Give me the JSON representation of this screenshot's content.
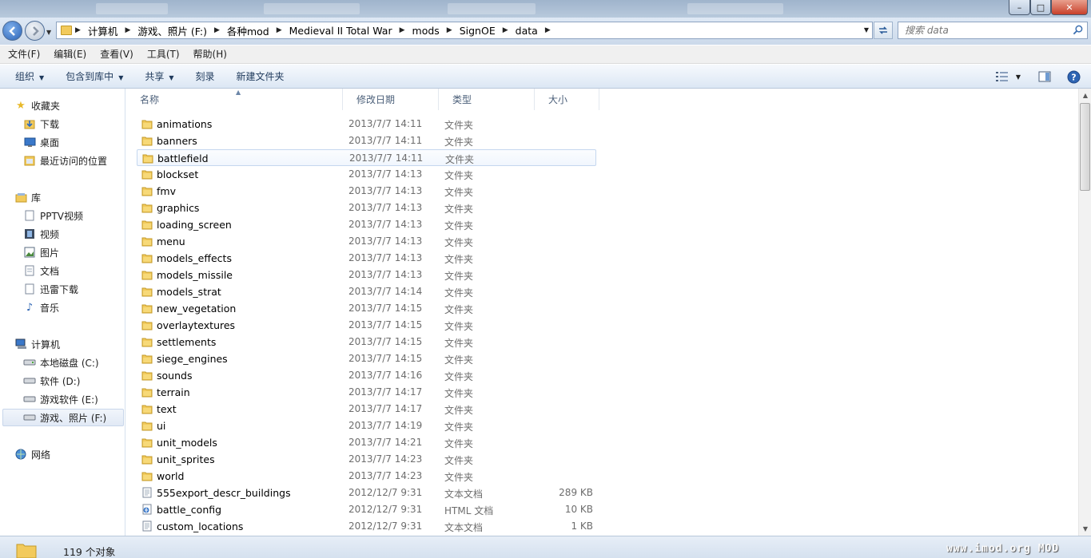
{
  "window": {
    "close_glyph": "✕",
    "maximize_glyph": "□",
    "minimize_glyph": "–"
  },
  "address": {
    "breadcrumbs": [
      "计算机",
      "游戏、照片 (F:)",
      "各种mod",
      "Medieval II Total War",
      "mods",
      "SignOE",
      "data"
    ],
    "search_placeholder": "搜索 data"
  },
  "menu": [
    "文件(F)",
    "编辑(E)",
    "查看(V)",
    "工具(T)",
    "帮助(H)"
  ],
  "toolbar": {
    "organize": "组织",
    "include_library": "包含到库中",
    "share": "共享",
    "burn": "刻录",
    "new_folder": "新建文件夹"
  },
  "nav": {
    "favorites": "收藏夹",
    "downloads": "下载",
    "desktop": "桌面",
    "recent": "最近访问的位置",
    "libraries": "库",
    "pptv": "PPTV视频",
    "videos": "视频",
    "pictures": "图片",
    "documents": "文档",
    "xunlei": "迅雷下载",
    "music": "音乐",
    "computer": "计算机",
    "drive_c": "本地磁盘 (C:)",
    "drive_d": "软件 (D:)",
    "drive_e": "游戏软件 (E:)",
    "drive_f": "游戏、照片 (F:)",
    "network": "网络"
  },
  "columns": {
    "name": "名称",
    "date": "修改日期",
    "type": "类型",
    "size": "大小"
  },
  "files": [
    {
      "name": "animations",
      "date": "2013/7/7 14:11",
      "type": "文件夹",
      "size": "",
      "kind": "folder"
    },
    {
      "name": "banners",
      "date": "2013/7/7 14:11",
      "type": "文件夹",
      "size": "",
      "kind": "folder"
    },
    {
      "name": "battlefield",
      "date": "2013/7/7 14:11",
      "type": "文件夹",
      "size": "",
      "kind": "folder"
    },
    {
      "name": "blockset",
      "date": "2013/7/7 14:13",
      "type": "文件夹",
      "size": "",
      "kind": "folder"
    },
    {
      "name": "fmv",
      "date": "2013/7/7 14:13",
      "type": "文件夹",
      "size": "",
      "kind": "folder"
    },
    {
      "name": "graphics",
      "date": "2013/7/7 14:13",
      "type": "文件夹",
      "size": "",
      "kind": "folder"
    },
    {
      "name": "loading_screen",
      "date": "2013/7/7 14:13",
      "type": "文件夹",
      "size": "",
      "kind": "folder"
    },
    {
      "name": "menu",
      "date": "2013/7/7 14:13",
      "type": "文件夹",
      "size": "",
      "kind": "folder"
    },
    {
      "name": "models_effects",
      "date": "2013/7/7 14:13",
      "type": "文件夹",
      "size": "",
      "kind": "folder"
    },
    {
      "name": "models_missile",
      "date": "2013/7/7 14:13",
      "type": "文件夹",
      "size": "",
      "kind": "folder"
    },
    {
      "name": "models_strat",
      "date": "2013/7/7 14:14",
      "type": "文件夹",
      "size": "",
      "kind": "folder"
    },
    {
      "name": "new_vegetation",
      "date": "2013/7/7 14:15",
      "type": "文件夹",
      "size": "",
      "kind": "folder"
    },
    {
      "name": "overlaytextures",
      "date": "2013/7/7 14:15",
      "type": "文件夹",
      "size": "",
      "kind": "folder"
    },
    {
      "name": "settlements",
      "date": "2013/7/7 14:15",
      "type": "文件夹",
      "size": "",
      "kind": "folder"
    },
    {
      "name": "siege_engines",
      "date": "2013/7/7 14:15",
      "type": "文件夹",
      "size": "",
      "kind": "folder"
    },
    {
      "name": "sounds",
      "date": "2013/7/7 14:16",
      "type": "文件夹",
      "size": "",
      "kind": "folder"
    },
    {
      "name": "terrain",
      "date": "2013/7/7 14:17",
      "type": "文件夹",
      "size": "",
      "kind": "folder"
    },
    {
      "name": "text",
      "date": "2013/7/7 14:17",
      "type": "文件夹",
      "size": "",
      "kind": "folder"
    },
    {
      "name": "ui",
      "date": "2013/7/7 14:19",
      "type": "文件夹",
      "size": "",
      "kind": "folder"
    },
    {
      "name": "unit_models",
      "date": "2013/7/7 14:21",
      "type": "文件夹",
      "size": "",
      "kind": "folder"
    },
    {
      "name": "unit_sprites",
      "date": "2013/7/7 14:23",
      "type": "文件夹",
      "size": "",
      "kind": "folder"
    },
    {
      "name": "world",
      "date": "2013/7/7 14:23",
      "type": "文件夹",
      "size": "",
      "kind": "folder"
    },
    {
      "name": "555export_descr_buildings",
      "date": "2012/12/7 9:31",
      "type": "文本文档",
      "size": "289 KB",
      "kind": "text"
    },
    {
      "name": "battle_config",
      "date": "2012/12/7 9:31",
      "type": "HTML 文档",
      "size": "10 KB",
      "kind": "html"
    },
    {
      "name": "custom_locations",
      "date": "2012/12/7 9:31",
      "type": "文本文档",
      "size": "1 KB",
      "kind": "text"
    }
  ],
  "hover_file": "battlefield",
  "status": {
    "count": "119 个对象"
  },
  "watermark": "www.imod.org MOD",
  "colors": {
    "folder": "#f2ca5c",
    "accent": "#1e395b",
    "hover_border": "#c5d7ef"
  }
}
